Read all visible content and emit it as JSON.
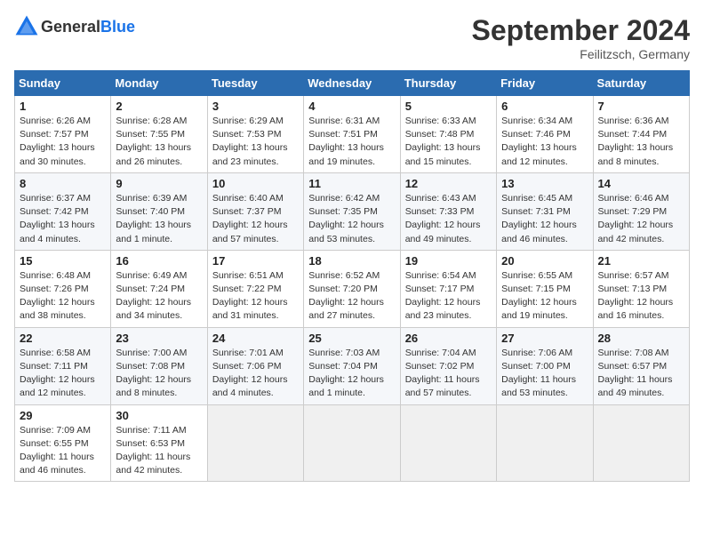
{
  "header": {
    "logo_general": "General",
    "logo_blue": "Blue",
    "month_title": "September 2024",
    "location": "Feilitzsch, Germany"
  },
  "weekdays": [
    "Sunday",
    "Monday",
    "Tuesday",
    "Wednesday",
    "Thursday",
    "Friday",
    "Saturday"
  ],
  "weeks": [
    [
      {
        "day": "1",
        "info": "Sunrise: 6:26 AM\nSunset: 7:57 PM\nDaylight: 13 hours\nand 30 minutes."
      },
      {
        "day": "2",
        "info": "Sunrise: 6:28 AM\nSunset: 7:55 PM\nDaylight: 13 hours\nand 26 minutes."
      },
      {
        "day": "3",
        "info": "Sunrise: 6:29 AM\nSunset: 7:53 PM\nDaylight: 13 hours\nand 23 minutes."
      },
      {
        "day": "4",
        "info": "Sunrise: 6:31 AM\nSunset: 7:51 PM\nDaylight: 13 hours\nand 19 minutes."
      },
      {
        "day": "5",
        "info": "Sunrise: 6:33 AM\nSunset: 7:48 PM\nDaylight: 13 hours\nand 15 minutes."
      },
      {
        "day": "6",
        "info": "Sunrise: 6:34 AM\nSunset: 7:46 PM\nDaylight: 13 hours\nand 12 minutes."
      },
      {
        "day": "7",
        "info": "Sunrise: 6:36 AM\nSunset: 7:44 PM\nDaylight: 13 hours\nand 8 minutes."
      }
    ],
    [
      {
        "day": "8",
        "info": "Sunrise: 6:37 AM\nSunset: 7:42 PM\nDaylight: 13 hours\nand 4 minutes."
      },
      {
        "day": "9",
        "info": "Sunrise: 6:39 AM\nSunset: 7:40 PM\nDaylight: 13 hours\nand 1 minute."
      },
      {
        "day": "10",
        "info": "Sunrise: 6:40 AM\nSunset: 7:37 PM\nDaylight: 12 hours\nand 57 minutes."
      },
      {
        "day": "11",
        "info": "Sunrise: 6:42 AM\nSunset: 7:35 PM\nDaylight: 12 hours\nand 53 minutes."
      },
      {
        "day": "12",
        "info": "Sunrise: 6:43 AM\nSunset: 7:33 PM\nDaylight: 12 hours\nand 49 minutes."
      },
      {
        "day": "13",
        "info": "Sunrise: 6:45 AM\nSunset: 7:31 PM\nDaylight: 12 hours\nand 46 minutes."
      },
      {
        "day": "14",
        "info": "Sunrise: 6:46 AM\nSunset: 7:29 PM\nDaylight: 12 hours\nand 42 minutes."
      }
    ],
    [
      {
        "day": "15",
        "info": "Sunrise: 6:48 AM\nSunset: 7:26 PM\nDaylight: 12 hours\nand 38 minutes."
      },
      {
        "day": "16",
        "info": "Sunrise: 6:49 AM\nSunset: 7:24 PM\nDaylight: 12 hours\nand 34 minutes."
      },
      {
        "day": "17",
        "info": "Sunrise: 6:51 AM\nSunset: 7:22 PM\nDaylight: 12 hours\nand 31 minutes."
      },
      {
        "day": "18",
        "info": "Sunrise: 6:52 AM\nSunset: 7:20 PM\nDaylight: 12 hours\nand 27 minutes."
      },
      {
        "day": "19",
        "info": "Sunrise: 6:54 AM\nSunset: 7:17 PM\nDaylight: 12 hours\nand 23 minutes."
      },
      {
        "day": "20",
        "info": "Sunrise: 6:55 AM\nSunset: 7:15 PM\nDaylight: 12 hours\nand 19 minutes."
      },
      {
        "day": "21",
        "info": "Sunrise: 6:57 AM\nSunset: 7:13 PM\nDaylight: 12 hours\nand 16 minutes."
      }
    ],
    [
      {
        "day": "22",
        "info": "Sunrise: 6:58 AM\nSunset: 7:11 PM\nDaylight: 12 hours\nand 12 minutes."
      },
      {
        "day": "23",
        "info": "Sunrise: 7:00 AM\nSunset: 7:08 PM\nDaylight: 12 hours\nand 8 minutes."
      },
      {
        "day": "24",
        "info": "Sunrise: 7:01 AM\nSunset: 7:06 PM\nDaylight: 12 hours\nand 4 minutes."
      },
      {
        "day": "25",
        "info": "Sunrise: 7:03 AM\nSunset: 7:04 PM\nDaylight: 12 hours\nand 1 minute."
      },
      {
        "day": "26",
        "info": "Sunrise: 7:04 AM\nSunset: 7:02 PM\nDaylight: 11 hours\nand 57 minutes."
      },
      {
        "day": "27",
        "info": "Sunrise: 7:06 AM\nSunset: 7:00 PM\nDaylight: 11 hours\nand 53 minutes."
      },
      {
        "day": "28",
        "info": "Sunrise: 7:08 AM\nSunset: 6:57 PM\nDaylight: 11 hours\nand 49 minutes."
      }
    ],
    [
      {
        "day": "29",
        "info": "Sunrise: 7:09 AM\nSunset: 6:55 PM\nDaylight: 11 hours\nand 46 minutes."
      },
      {
        "day": "30",
        "info": "Sunrise: 7:11 AM\nSunset: 6:53 PM\nDaylight: 11 hours\nand 42 minutes."
      },
      {
        "day": "",
        "info": ""
      },
      {
        "day": "",
        "info": ""
      },
      {
        "day": "",
        "info": ""
      },
      {
        "day": "",
        "info": ""
      },
      {
        "day": "",
        "info": ""
      }
    ]
  ]
}
